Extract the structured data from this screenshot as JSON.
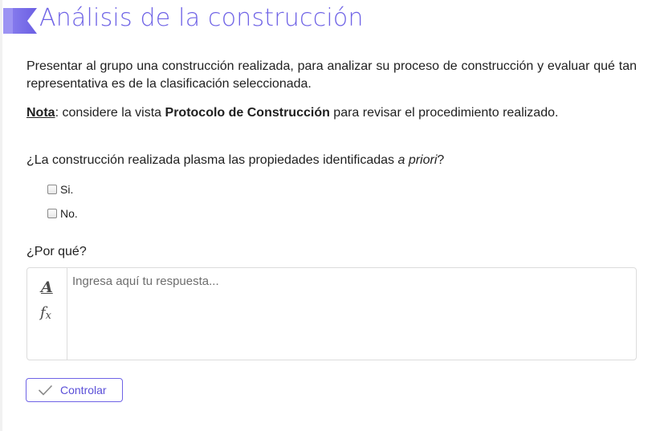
{
  "header": {
    "title": "Análisis de la construcción",
    "accent_color": "#6f63e6",
    "flag_icon": "bookmark-flag-icon"
  },
  "content": {
    "intro": "Presentar al grupo una construcción realizada, para analizar su proceso de construcción y evaluar qué tan representativa es de la clasificación seleccionada.",
    "note": {
      "label": "Nota",
      "text_before": ": considere la vista ",
      "bold": "Protocolo de Construcción",
      "text_after": " para revisar el procedimiento realizado."
    },
    "question": {
      "text": "¿La construcción realizada plasma las propiedades identificadas ",
      "italic": "a priori",
      "end": "?"
    },
    "options": [
      {
        "label": "Si.",
        "checked": false
      },
      {
        "label": "No.",
        "checked": false
      }
    ],
    "why_label": "¿Por qué?"
  },
  "editor": {
    "placeholder": "Ingresa aquí tu respuesta...",
    "value": "",
    "tools": [
      {
        "icon": "text-format-icon",
        "glyph": "A"
      },
      {
        "icon": "formula-icon",
        "glyph": "f",
        "sub": "x"
      }
    ]
  },
  "actions": {
    "check_label": "Controlar",
    "check_icon": "checkmark-icon"
  }
}
